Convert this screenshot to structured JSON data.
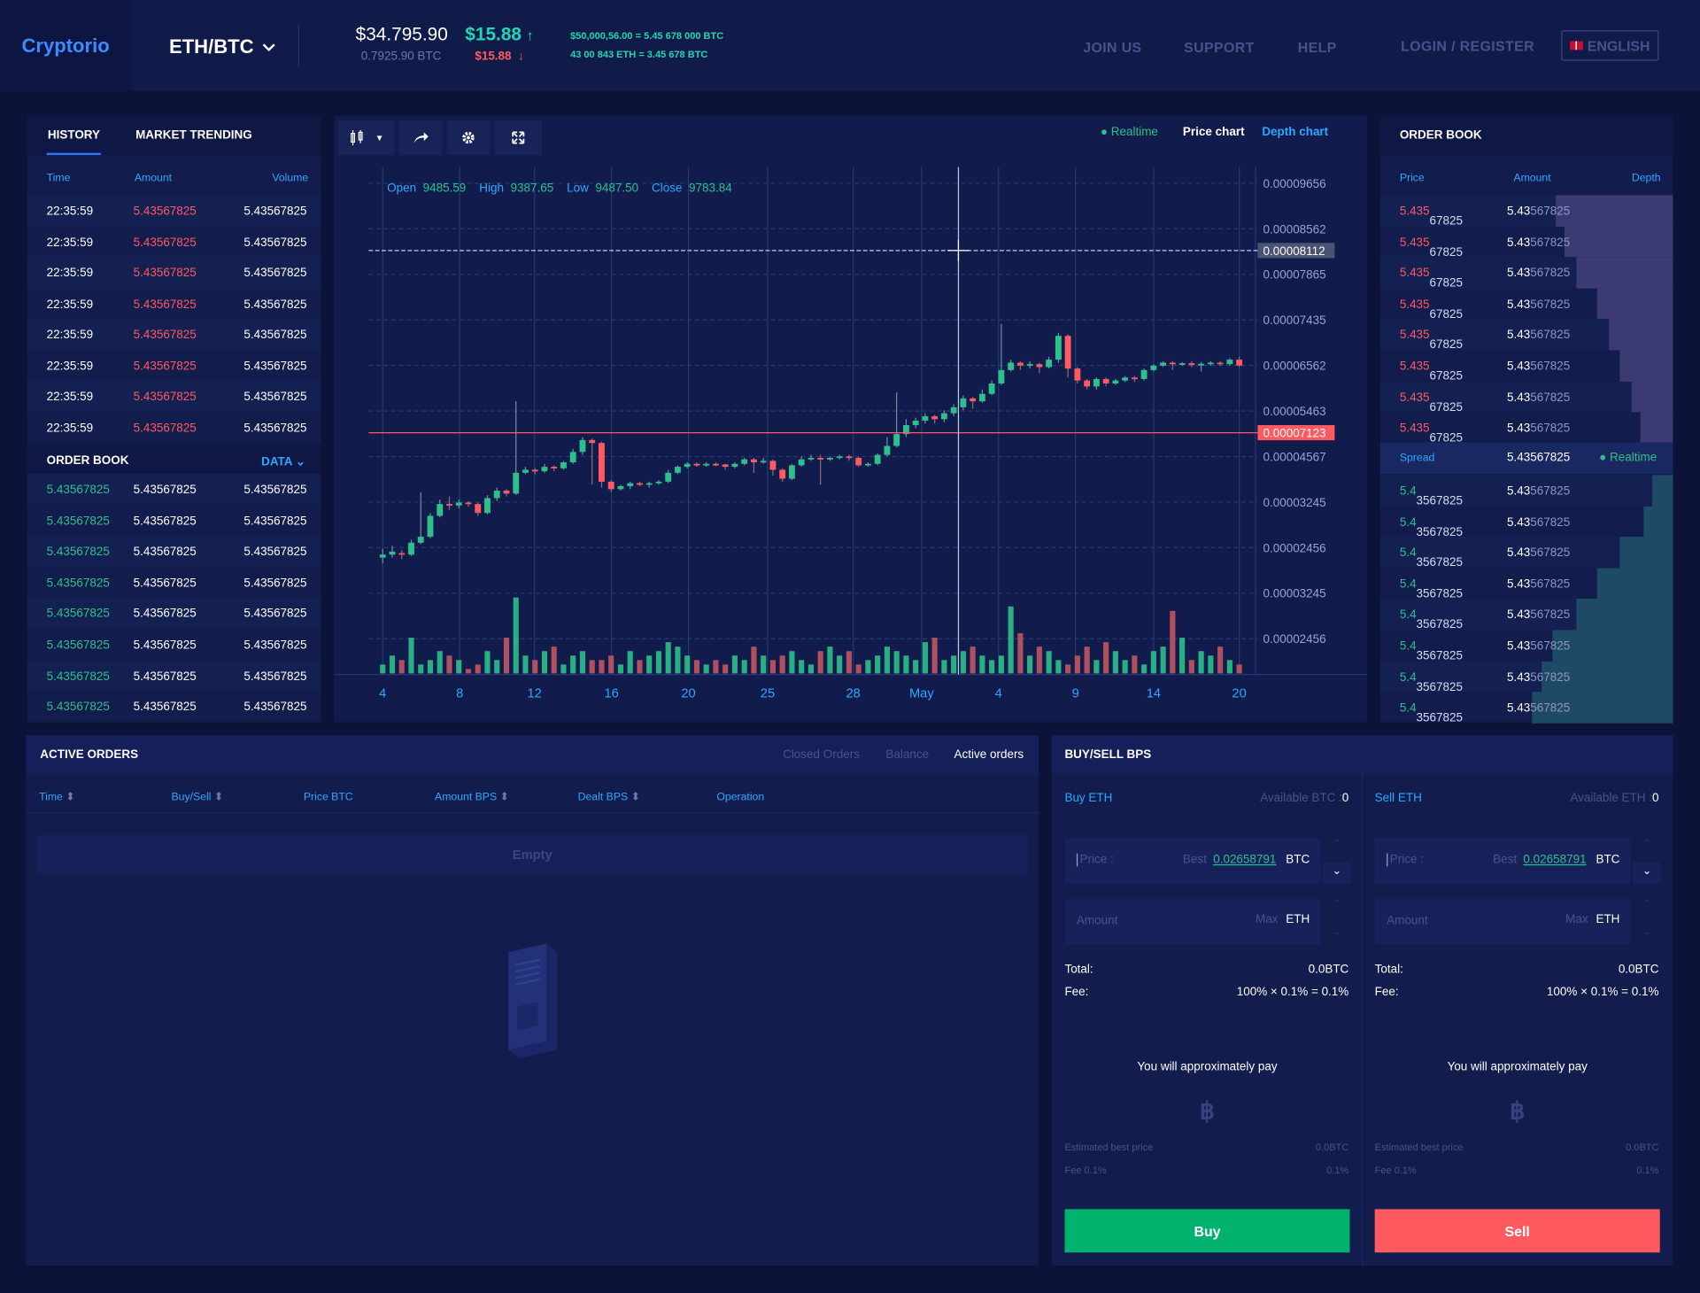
{
  "header": {
    "logo": "Cryptorio",
    "pair": "ETH/BTC",
    "price_usd": "$34.795.90",
    "price_btc": "0.7925.90 BTC",
    "change_up": "$15.88",
    "change_down": "$15.88",
    "conversion_1": "$50,000,56.00 = 5.45 678 000 BTC",
    "conversion_2": "43 00 843 ETH = 3.45 678 BTC",
    "nav": [
      "JOIN US",
      "SUPPORT",
      "HELP"
    ],
    "login": "LOGIN / REGISTER",
    "language": "ENGLISH"
  },
  "history": {
    "tabs": [
      "HISTORY",
      "MARKET TRENDING"
    ],
    "columns": [
      "Time",
      "Amount",
      "Volume"
    ],
    "rows": [
      {
        "time": "22:35:59",
        "amount": "5.43567825",
        "volume": "5.43567825"
      },
      {
        "time": "22:35:59",
        "amount": "5.43567825",
        "volume": "5.43567825"
      },
      {
        "time": "22:35:59",
        "amount": "5.43567825",
        "volume": "5.43567825"
      },
      {
        "time": "22:35:59",
        "amount": "5.43567825",
        "volume": "5.43567825"
      },
      {
        "time": "22:35:59",
        "amount": "5.43567825",
        "volume": "5.43567825"
      },
      {
        "time": "22:35:59",
        "amount": "5.43567825",
        "volume": "5.43567825"
      },
      {
        "time": "22:35:59",
        "amount": "5.43567825",
        "volume": "5.43567825"
      },
      {
        "time": "22:35:59",
        "amount": "5.43567825",
        "volume": "5.43567825"
      }
    ],
    "order_book_title": "ORDER BOOK",
    "data_label": "DATA",
    "order_rows": [
      {
        "price": "5.43567825",
        "amount": "5.43567825",
        "total": "5.43567825"
      },
      {
        "price": "5.43567825",
        "amount": "5.43567825",
        "total": "5.43567825"
      },
      {
        "price": "5.43567825",
        "amount": "5.43567825",
        "total": "5.43567825"
      },
      {
        "price": "5.43567825",
        "amount": "5.43567825",
        "total": "5.43567825"
      },
      {
        "price": "5.43567825",
        "amount": "5.43567825",
        "total": "5.43567825"
      },
      {
        "price": "5.43567825",
        "amount": "5.43567825",
        "total": "5.43567825"
      },
      {
        "price": "5.43567825",
        "amount": "5.43567825",
        "total": "5.43567825"
      },
      {
        "price": "5.43567825",
        "amount": "5.43567825",
        "total": "5.43567825"
      }
    ]
  },
  "chart": {
    "realtime": "Realtime",
    "price_chart": "Price chart",
    "depth_chart": "Depth chart",
    "ohlc": {
      "open_label": "Open",
      "open": "9485.59",
      "high_label": "High",
      "high": "9387.65",
      "low_label": "Low",
      "low": "9487.50",
      "close_label": "Close",
      "close": "9783.84"
    },
    "crosshair_value": "0.00008112",
    "current_value": "0.00007123",
    "colors": {
      "up": "#2ec08b",
      "down": "#ff5a5f",
      "grid": "#1f3a6b",
      "accent": "#2ba9ff"
    }
  },
  "chart_data": {
    "type": "candlestick",
    "y_ticks": [
      "0.00009656",
      "0.00008562",
      "0.00007865",
      "0.00007435",
      "0.00006562",
      "0.00005463",
      "0.00004567",
      "0.00003245",
      "0.00002456",
      "0.00003245",
      "0.00002456"
    ],
    "x_ticks": [
      "4",
      "8",
      "12",
      "16",
      "20",
      "25",
      "28",
      "May",
      "4",
      "9",
      "14",
      "20"
    ],
    "candles": [
      {
        "o": 5215,
        "c": 5225,
        "h": 5245,
        "l": 5195
      },
      {
        "o": 5225,
        "c": 5235,
        "h": 5255,
        "l": 5215
      },
      {
        "o": 5230,
        "c": 5225,
        "h": 5240,
        "l": 5210
      },
      {
        "o": 5225,
        "c": 5265,
        "h": 5275,
        "l": 5220
      },
      {
        "o": 5265,
        "c": 5285,
        "h": 5435,
        "l": 5260
      },
      {
        "o": 5285,
        "c": 5355,
        "h": 5365,
        "l": 5280
      },
      {
        "o": 5355,
        "c": 5395,
        "h": 5410,
        "l": 5350
      },
      {
        "o": 5395,
        "c": 5390,
        "h": 5420,
        "l": 5375
      },
      {
        "o": 5390,
        "c": 5400,
        "h": 5410,
        "l": 5380
      },
      {
        "o": 5400,
        "c": 5395,
        "h": 5405,
        "l": 5385
      },
      {
        "o": 5395,
        "c": 5365,
        "h": 5400,
        "l": 5355
      },
      {
        "o": 5365,
        "c": 5415,
        "h": 5425,
        "l": 5360
      },
      {
        "o": 5415,
        "c": 5440,
        "h": 5450,
        "l": 5405
      },
      {
        "o": 5440,
        "c": 5430,
        "h": 5445,
        "l": 5420
      },
      {
        "o": 5430,
        "c": 5500,
        "h": 5740,
        "l": 5425
      },
      {
        "o": 5500,
        "c": 5510,
        "h": 5520,
        "l": 5495
      },
      {
        "o": 5510,
        "c": 5505,
        "h": 5515,
        "l": 5495
      },
      {
        "o": 5505,
        "c": 5520,
        "h": 5530,
        "l": 5500
      },
      {
        "o": 5520,
        "c": 5515,
        "h": 5525,
        "l": 5505
      },
      {
        "o": 5515,
        "c": 5535,
        "h": 5540,
        "l": 5510
      },
      {
        "o": 5535,
        "c": 5570,
        "h": 5580,
        "l": 5530
      },
      {
        "o": 5570,
        "c": 5610,
        "h": 5620,
        "l": 5560
      },
      {
        "o": 5610,
        "c": 5600,
        "h": 5615,
        "l": 5460
      },
      {
        "o": 5600,
        "c": 5470,
        "h": 5605,
        "l": 5450
      },
      {
        "o": 5470,
        "c": 5445,
        "h": 5475,
        "l": 5435
      },
      {
        "o": 5445,
        "c": 5455,
        "h": 5460,
        "l": 5440
      },
      {
        "o": 5455,
        "c": 5465,
        "h": 5470,
        "l": 5445
      },
      {
        "o": 5465,
        "c": 5460,
        "h": 5470,
        "l": 5455
      },
      {
        "o": 5460,
        "c": 5465,
        "h": 5470,
        "l": 5450
      },
      {
        "o": 5465,
        "c": 5470,
        "h": 5475,
        "l": 5460
      },
      {
        "o": 5470,
        "c": 5500,
        "h": 5510,
        "l": 5465
      },
      {
        "o": 5500,
        "c": 5520,
        "h": 5525,
        "l": 5495
      },
      {
        "o": 5520,
        "c": 5530,
        "h": 5535,
        "l": 5515
      },
      {
        "o": 5530,
        "c": 5525,
        "h": 5535,
        "l": 5520
      },
      {
        "o": 5525,
        "c": 5530,
        "h": 5535,
        "l": 5520
      },
      {
        "o": 5530,
        "c": 5528,
        "h": 5535,
        "l": 5522
      },
      {
        "o": 5528,
        "c": 5520,
        "h": 5530,
        "l": 5510
      },
      {
        "o": 5520,
        "c": 5530,
        "h": 5535,
        "l": 5515
      },
      {
        "o": 5530,
        "c": 5545,
        "h": 5550,
        "l": 5525
      },
      {
        "o": 5545,
        "c": 5535,
        "h": 5550,
        "l": 5500
      },
      {
        "o": 5535,
        "c": 5540,
        "h": 5550,
        "l": 5530
      },
      {
        "o": 5540,
        "c": 5510,
        "h": 5545,
        "l": 5490
      },
      {
        "o": 5510,
        "c": 5480,
        "h": 5515,
        "l": 5470
      },
      {
        "o": 5480,
        "c": 5525,
        "h": 5530,
        "l": 5475
      },
      {
        "o": 5525,
        "c": 5545,
        "h": 5555,
        "l": 5520
      },
      {
        "o": 5545,
        "c": 5550,
        "h": 5560,
        "l": 5540
      },
      {
        "o": 5550,
        "c": 5545,
        "h": 5560,
        "l": 5460
      },
      {
        "o": 5545,
        "c": 5550,
        "h": 5555,
        "l": 5540
      },
      {
        "o": 5550,
        "c": 5555,
        "h": 5560,
        "l": 5545
      },
      {
        "o": 5555,
        "c": 5550,
        "h": 5560,
        "l": 5540
      },
      {
        "o": 5550,
        "c": 5525,
        "h": 5555,
        "l": 5520
      },
      {
        "o": 5525,
        "c": 5530,
        "h": 5535,
        "l": 5520
      },
      {
        "o": 5530,
        "c": 5560,
        "h": 5565,
        "l": 5525
      },
      {
        "o": 5560,
        "c": 5590,
        "h": 5620,
        "l": 5555
      },
      {
        "o": 5590,
        "c": 5630,
        "h": 5770,
        "l": 5585
      },
      {
        "o": 5630,
        "c": 5660,
        "h": 5680,
        "l": 5620
      },
      {
        "o": 5660,
        "c": 5675,
        "h": 5685,
        "l": 5650
      },
      {
        "o": 5675,
        "c": 5690,
        "h": 5700,
        "l": 5665
      },
      {
        "o": 5690,
        "c": 5680,
        "h": 5695,
        "l": 5665
      },
      {
        "o": 5680,
        "c": 5700,
        "h": 5710,
        "l": 5670
      },
      {
        "o": 5700,
        "c": 5720,
        "h": 5730,
        "l": 5690
      },
      {
        "o": 5720,
        "c": 5750,
        "h": 5760,
        "l": 5710
      },
      {
        "o": 5750,
        "c": 5740,
        "h": 5755,
        "l": 5715
      },
      {
        "o": 5740,
        "c": 5765,
        "h": 5780,
        "l": 5735
      },
      {
        "o": 5765,
        "c": 5800,
        "h": 5810,
        "l": 5760
      },
      {
        "o": 5800,
        "c": 5845,
        "h": 6000,
        "l": 5795
      },
      {
        "o": 5845,
        "c": 5870,
        "h": 5880,
        "l": 5840
      },
      {
        "o": 5870,
        "c": 5860,
        "h": 5875,
        "l": 5845
      },
      {
        "o": 5860,
        "c": 5865,
        "h": 5875,
        "l": 5850
      },
      {
        "o": 5865,
        "c": 5855,
        "h": 5870,
        "l": 5835
      },
      {
        "o": 5855,
        "c": 5880,
        "h": 5890,
        "l": 5850
      },
      {
        "o": 5880,
        "c": 5960,
        "h": 5970,
        "l": 5870
      },
      {
        "o": 5960,
        "c": 5850,
        "h": 5965,
        "l": 5820
      },
      {
        "o": 5850,
        "c": 5810,
        "h": 5855,
        "l": 5800
      },
      {
        "o": 5810,
        "c": 5790,
        "h": 5815,
        "l": 5780
      },
      {
        "o": 5790,
        "c": 5815,
        "h": 5820,
        "l": 5780
      },
      {
        "o": 5815,
        "c": 5800,
        "h": 5820,
        "l": 5790
      },
      {
        "o": 5800,
        "c": 5810,
        "h": 5815,
        "l": 5795
      },
      {
        "o": 5810,
        "c": 5820,
        "h": 5825,
        "l": 5805
      },
      {
        "o": 5820,
        "c": 5815,
        "h": 5825,
        "l": 5805
      },
      {
        "o": 5815,
        "c": 5845,
        "h": 5850,
        "l": 5810
      },
      {
        "o": 5845,
        "c": 5860,
        "h": 5865,
        "l": 5840
      },
      {
        "o": 5860,
        "c": 5870,
        "h": 5875,
        "l": 5855
      },
      {
        "o": 5870,
        "c": 5865,
        "h": 5875,
        "l": 5845
      },
      {
        "o": 5865,
        "c": 5868,
        "h": 5872,
        "l": 5860
      },
      {
        "o": 5868,
        "c": 5862,
        "h": 5875,
        "l": 5855
      },
      {
        "o": 5862,
        "c": 5866,
        "h": 5872,
        "l": 5840
      },
      {
        "o": 5866,
        "c": 5870,
        "h": 5875,
        "l": 5860
      },
      {
        "o": 5870,
        "c": 5865,
        "h": 5875,
        "l": 5860
      },
      {
        "o": 5865,
        "c": 5880,
        "h": 5885,
        "l": 5860
      },
      {
        "o": 5880,
        "c": 5860,
        "h": 5890,
        "l": 5855
      }
    ],
    "volumes": [
      2,
      4,
      3,
      8,
      2,
      3,
      5,
      4,
      3,
      1,
      2,
      5,
      3,
      8,
      17,
      4,
      3,
      5,
      6,
      2,
      4,
      5,
      3,
      3,
      4,
      2,
      5,
      3,
      4,
      5,
      7,
      6,
      4,
      3,
      2,
      3,
      2,
      4,
      3,
      6,
      4,
      3,
      4,
      5,
      3,
      2,
      5,
      6,
      4,
      5,
      2,
      3,
      4,
      6,
      5,
      4,
      3,
      7,
      8,
      3,
      4,
      5,
      6,
      4,
      3,
      4,
      15,
      9,
      4,
      6,
      5,
      3,
      2,
      4,
      6,
      3,
      7,
      5,
      3,
      4,
      2,
      5,
      6,
      14,
      8,
      3,
      5,
      4,
      6,
      3,
      2
    ]
  },
  "order_book": {
    "title": "ORDER BOOK",
    "columns": [
      "Price",
      "Amount",
      "Depth"
    ],
    "asks": [
      {
        "price_hi": "5.435",
        "price_lo": "67825",
        "amount_hi": "5.43",
        "amount_lo": "567825",
        "depth": 0.4
      },
      {
        "price_hi": "5.435",
        "price_lo": "67825",
        "amount_hi": "5.43",
        "amount_lo": "567825",
        "depth": 0.37
      },
      {
        "price_hi": "5.435",
        "price_lo": "67825",
        "amount_hi": "5.43",
        "amount_lo": "567825",
        "depth": 0.33
      },
      {
        "price_hi": "5.435",
        "price_lo": "67825",
        "amount_hi": "5.43",
        "amount_lo": "567825",
        "depth": 0.26
      },
      {
        "price_hi": "5.435",
        "price_lo": "67825",
        "amount_hi": "5.43",
        "amount_lo": "567825",
        "depth": 0.22
      },
      {
        "price_hi": "5.435",
        "price_lo": "67825",
        "amount_hi": "5.43",
        "amount_lo": "567825",
        "depth": 0.18
      },
      {
        "price_hi": "5.435",
        "price_lo": "67825",
        "amount_hi": "5.43",
        "amount_lo": "567825",
        "depth": 0.14
      },
      {
        "price_hi": "5.435",
        "price_lo": "67825",
        "amount_hi": "5.43",
        "amount_lo": "567825",
        "depth": 0.11
      }
    ],
    "spread_label": "Spread",
    "spread_value": "5.43567825",
    "realtime": "Realtime",
    "bids": [
      {
        "price_hi": "5.4",
        "price_lo": "3567825",
        "amount_hi": "5.43",
        "amount_lo": "567825",
        "depth": 0.07
      },
      {
        "price_hi": "5.4",
        "price_lo": "3567825",
        "amount_hi": "5.43",
        "amount_lo": "567825",
        "depth": 0.1
      },
      {
        "price_hi": "5.4",
        "price_lo": "3567825",
        "amount_hi": "5.43",
        "amount_lo": "567825",
        "depth": 0.18
      },
      {
        "price_hi": "5.4",
        "price_lo": "3567825",
        "amount_hi": "5.43",
        "amount_lo": "567825",
        "depth": 0.26
      },
      {
        "price_hi": "5.4",
        "price_lo": "3567825",
        "amount_hi": "5.43",
        "amount_lo": "567825",
        "depth": 0.33
      },
      {
        "price_hi": "5.4",
        "price_lo": "3567825",
        "amount_hi": "5.43",
        "amount_lo": "567825",
        "depth": 0.41
      },
      {
        "price_hi": "5.4",
        "price_lo": "3567825",
        "amount_hi": "5.43",
        "amount_lo": "567825",
        "depth": 0.45
      },
      {
        "price_hi": "5.4",
        "price_lo": "3567825",
        "amount_hi": "5.43",
        "amount_lo": "567825",
        "depth": 0.48
      }
    ]
  },
  "active_orders": {
    "title": "ACTIVE ORDERS",
    "tabs": [
      "Closed Orders",
      "Balance",
      "Active orders"
    ],
    "columns": [
      "Time",
      "Buy/Sell",
      "Price BTC",
      "Amount BPS",
      "Dealt BPS",
      "Operation"
    ],
    "empty": "Empty"
  },
  "buysell": {
    "title": "BUY/SELL BPS",
    "buy": {
      "title": "Buy ETH",
      "available_label": "Available BTC :",
      "available_value": "0",
      "price_placeholder": "Price :",
      "best_label": "Best",
      "best_value": "0.02658791",
      "price_unit": "BTC",
      "amount_placeholder": "Amount",
      "max_label": "Max",
      "amount_unit": "ETH",
      "total_label": "Total:",
      "total_value": "0.0BTC",
      "fee_label": "Fee:",
      "fee_value": "100% × 0.1% = 0.1%",
      "pay_label": "You will approximately pay",
      "estimated_label": "Estimated best price",
      "estimated_value": "0.0BTC",
      "fee_small_label": "Fee 0.1%",
      "fee_small_value": "0.1%",
      "button": "Buy"
    },
    "sell": {
      "title": "Sell ETH",
      "available_label": "Available ETH :",
      "available_value": "0",
      "price_placeholder": "Price :",
      "best_label": "Best",
      "best_value": "0.02658791",
      "price_unit": "BTC",
      "amount_placeholder": "Amount",
      "max_label": "Max",
      "amount_unit": "ETH",
      "total_label": "Total:",
      "total_value": "0.0BTC",
      "fee_label": "Fee:",
      "fee_value": "100% × 0.1% = 0.1%",
      "pay_label": "You will approximately pay",
      "estimated_label": "Estimated best price",
      "estimated_value": "0.0BTC",
      "fee_small_label": "Fee 0.1%",
      "fee_small_value": "0.1%",
      "button": "Sell"
    }
  }
}
